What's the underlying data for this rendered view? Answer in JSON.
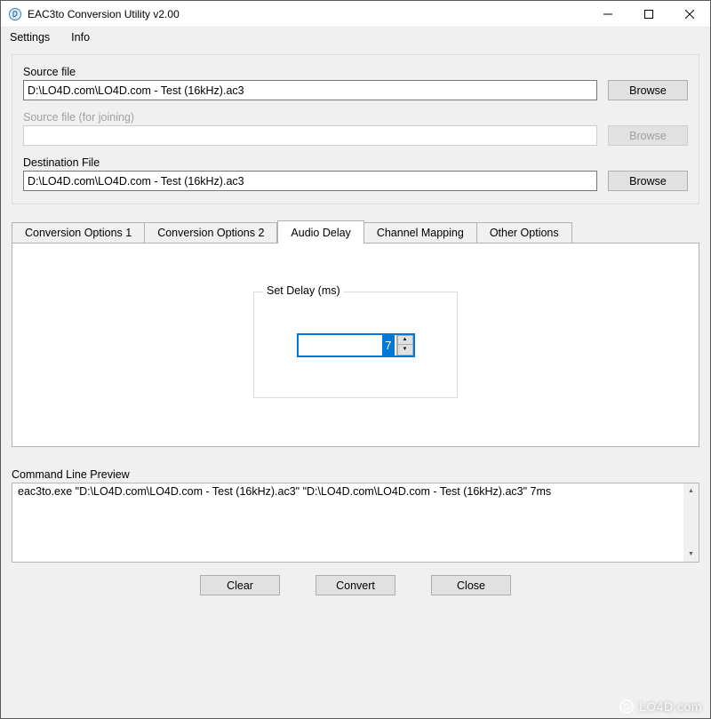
{
  "window": {
    "title": "EAC3to Conversion Utility   v2.00"
  },
  "menubar": {
    "settings": "Settings",
    "info": "Info"
  },
  "files": {
    "source_label": "Source file",
    "source_value": "D:\\LO4D.com\\LO4D.com - Test (16kHz).ac3",
    "source_browse": "Browse",
    "join_label": "Source file (for joining)",
    "join_value": "",
    "join_browse": "Browse",
    "dest_label": "Destination File",
    "dest_value": "D:\\LO4D.com\\LO4D.com - Test (16kHz).ac3",
    "dest_browse": "Browse"
  },
  "tabs": {
    "t1": "Conversion Options 1",
    "t2": "Conversion Options 2",
    "t3": "Audio Delay",
    "t4": "Channel Mapping",
    "t5": "Other Options"
  },
  "delay": {
    "legend": "Set Delay (ms)",
    "value": "7"
  },
  "cmd": {
    "label": "Command Line Preview",
    "text": "eac3to.exe \"D:\\LO4D.com\\LO4D.com - Test (16kHz).ac3\"  \"D:\\LO4D.com\\LO4D.com - Test (16kHz).ac3\"   7ms"
  },
  "buttons": {
    "clear": "Clear",
    "convert": "Convert",
    "close": "Close"
  },
  "watermark": "LO4D.com"
}
